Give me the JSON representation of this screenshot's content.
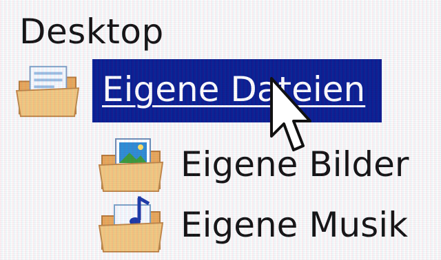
{
  "tree": {
    "root_label": "Desktop",
    "items": [
      {
        "label": "Eigene Dateien",
        "icon": "folder-documents-icon",
        "selected": true
      },
      {
        "label": "Eigene Bilder",
        "icon": "folder-pictures-icon",
        "selected": false
      },
      {
        "label": "Eigene Musik",
        "icon": "folder-music-icon",
        "selected": false
      }
    ]
  },
  "colors": {
    "selection_background": "#0b1f93",
    "selection_text": "#ffffff",
    "text": "#141414",
    "folder": "#f2c77a"
  },
  "cursor": {
    "icon": "arrow-cursor-icon"
  }
}
